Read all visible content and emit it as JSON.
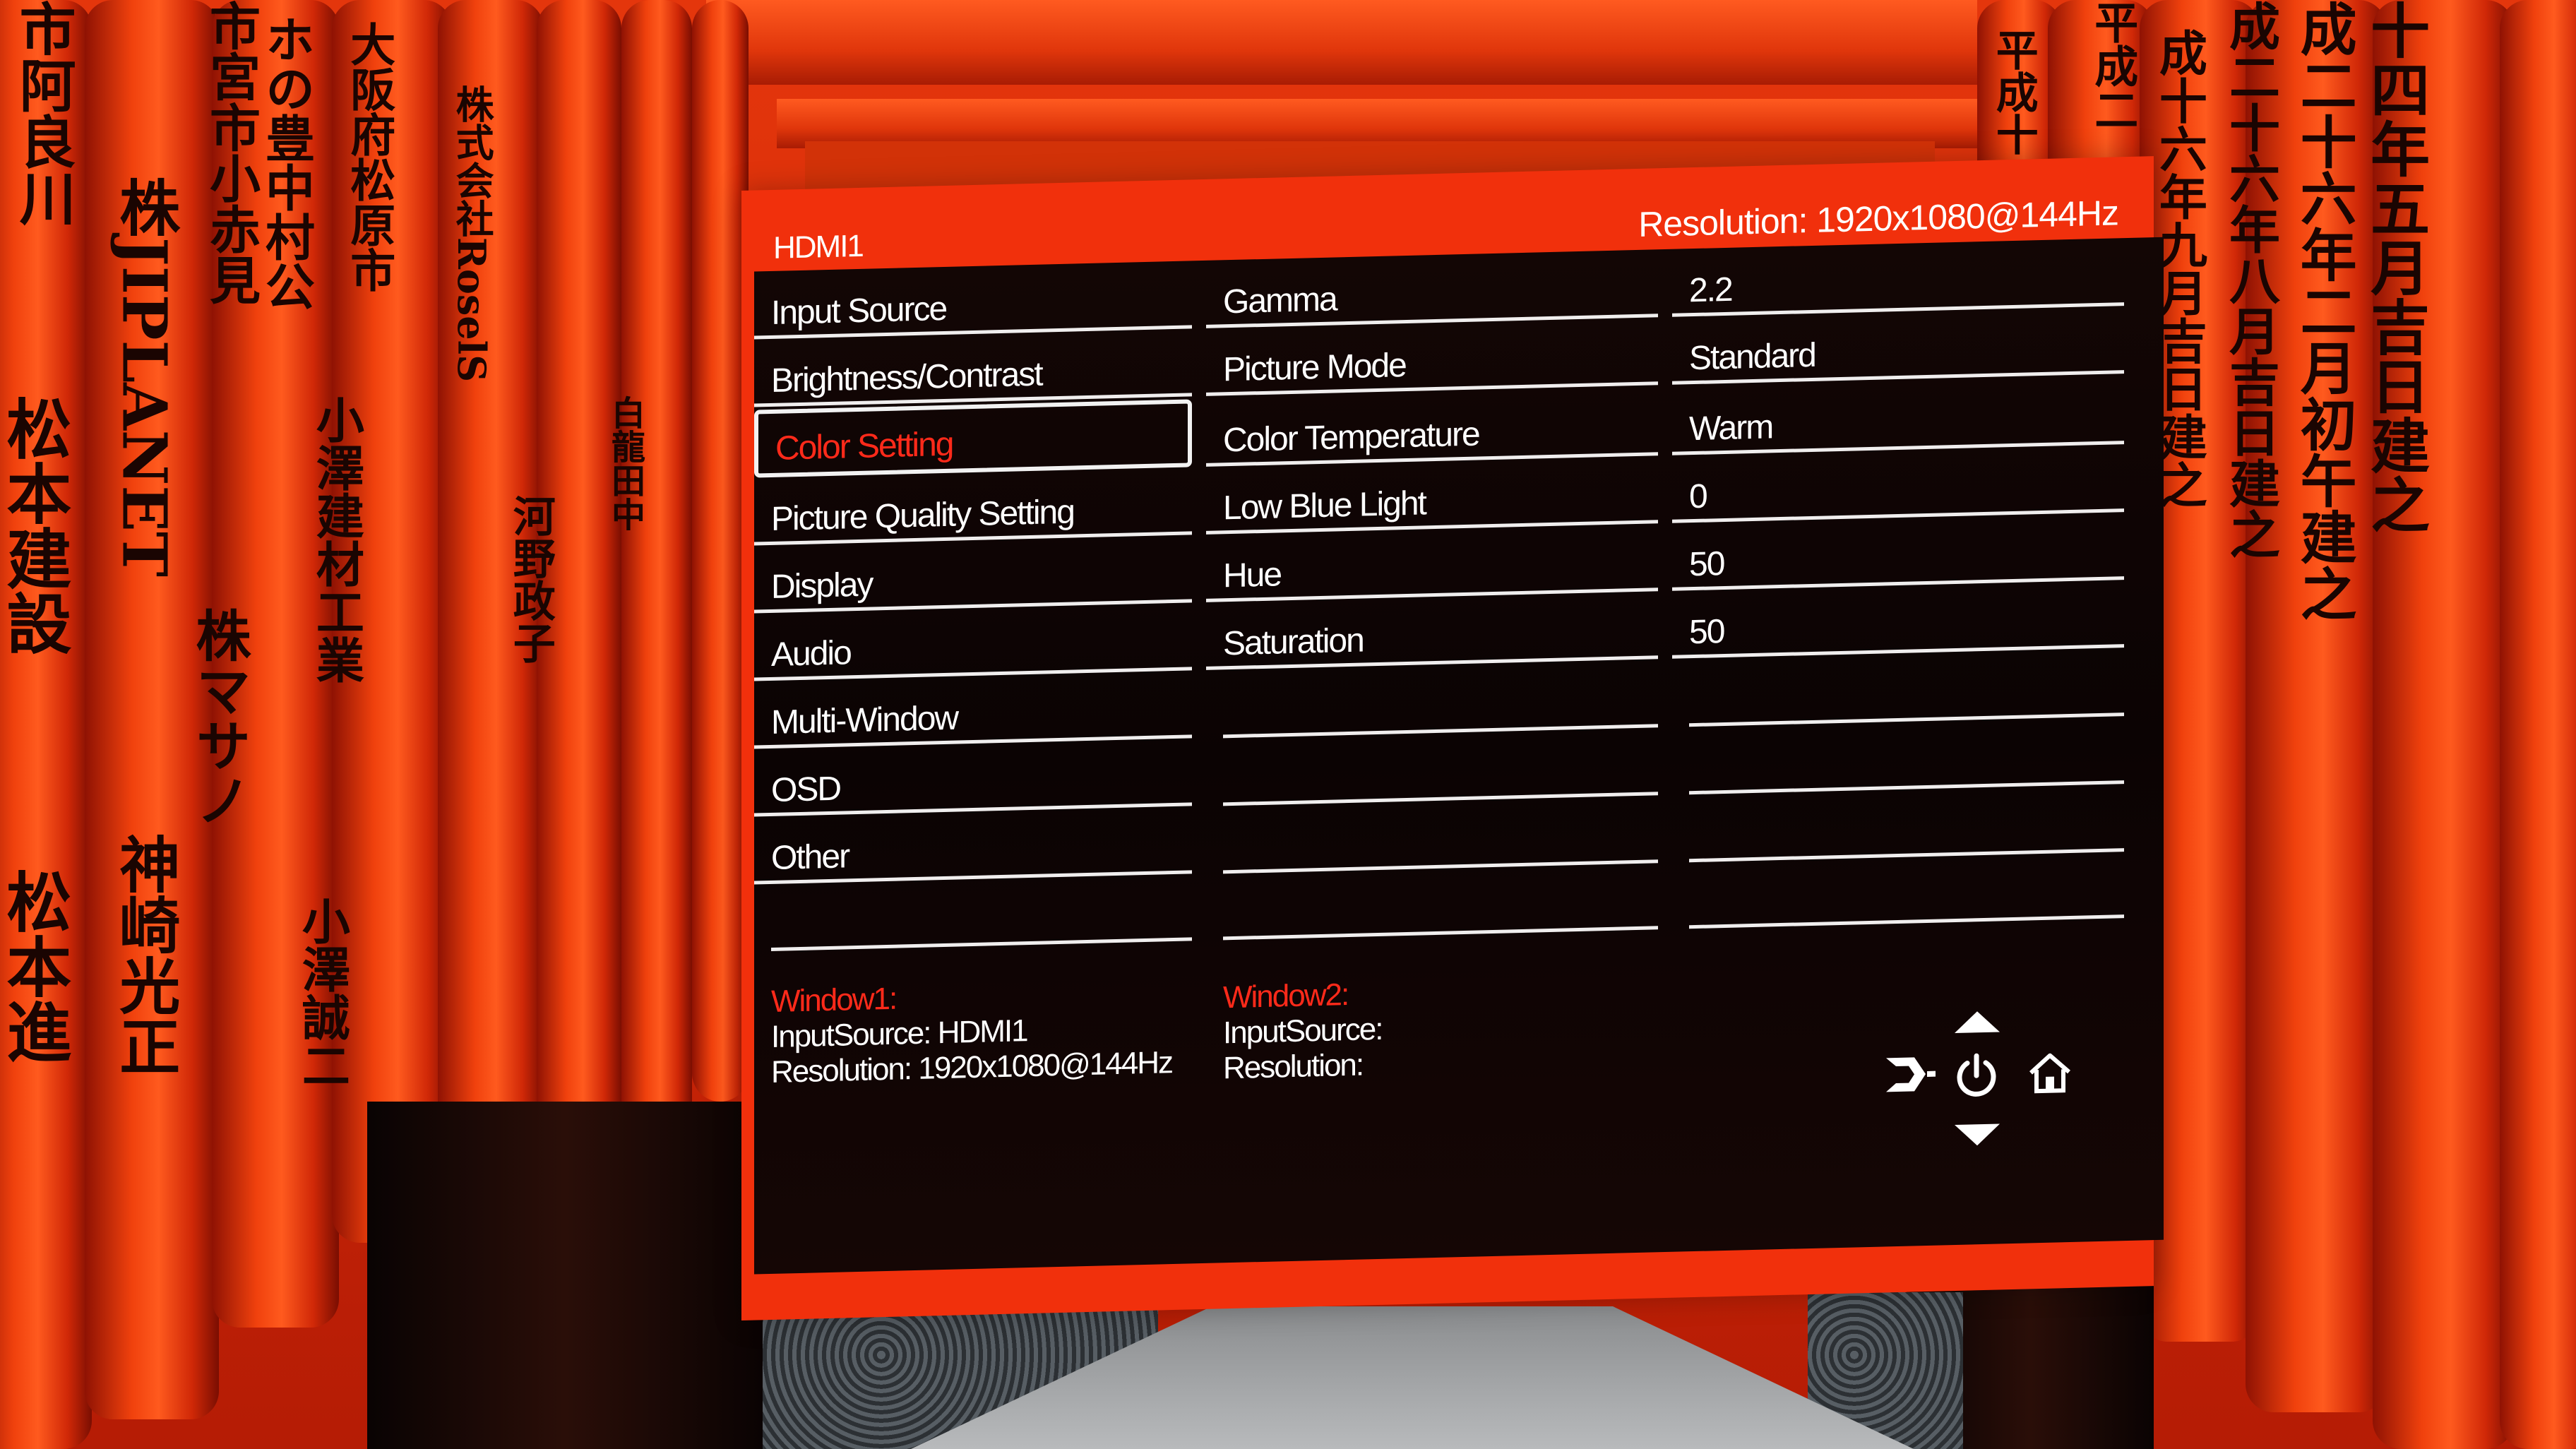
{
  "osd": {
    "header": {
      "input": "HDMI1",
      "resolution": "Resolution:  1920x1080@144Hz"
    },
    "menu": [
      {
        "label": "Input Source"
      },
      {
        "label": "Brightness/Contrast"
      },
      {
        "label": "Color Setting",
        "selected": true
      },
      {
        "label": "Picture Quality Setting"
      },
      {
        "label": "Display"
      },
      {
        "label": "Audio"
      },
      {
        "label": "Multi-Window"
      },
      {
        "label": "OSD"
      },
      {
        "label": "Other"
      }
    ],
    "settings": [
      {
        "label": "Gamma",
        "value": "2.2"
      },
      {
        "label": "Picture Mode",
        "value": "Standard"
      },
      {
        "label": "Color Temperature",
        "value": "Warm"
      },
      {
        "label": "Low Blue Light",
        "value": "0"
      },
      {
        "label": "Hue",
        "value": "50"
      },
      {
        "label": "Saturation",
        "value": "50"
      }
    ],
    "window1": {
      "title": "Window1:",
      "input_source": "InputSource:  HDMI1",
      "resolution": "Resolution:  1920x1080@144Hz"
    },
    "window2": {
      "title": "Window2:",
      "input_source": "InputSource:",
      "resolution": "Resolution:"
    },
    "nav_icons": [
      "up-arrow-icon",
      "exit-icon",
      "power-icon",
      "home-icon",
      "down-arrow-icon"
    ],
    "colors": {
      "frame": "#f1300c",
      "panel": "#0c0403",
      "highlight": "#ff2a1a",
      "text": "#ffffff"
    }
  }
}
